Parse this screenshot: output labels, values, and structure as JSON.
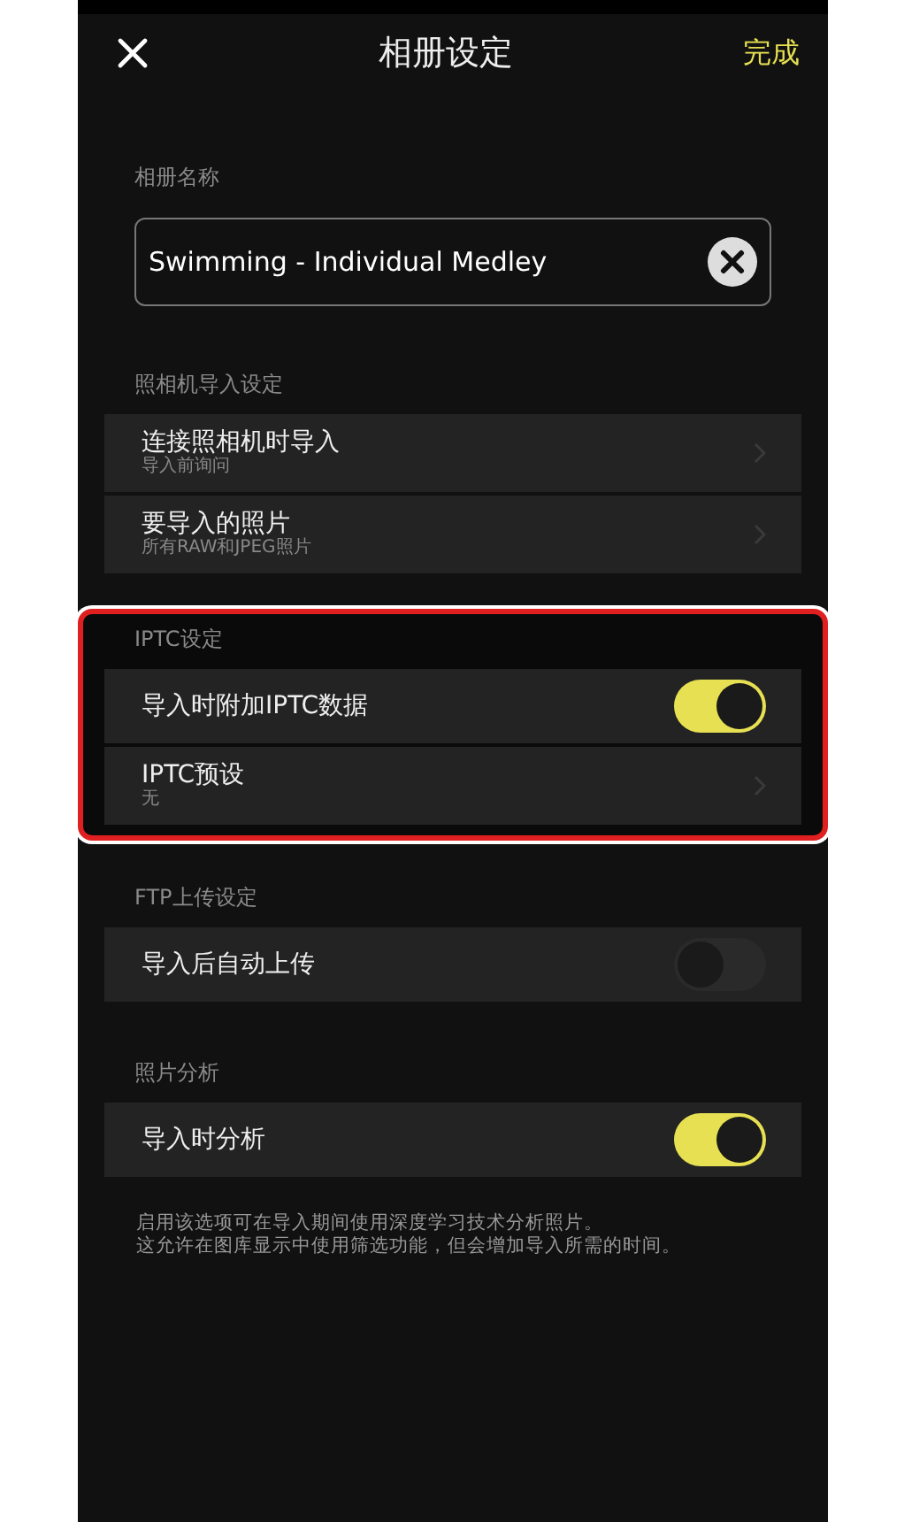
{
  "header": {
    "title": "相册设定",
    "done": "完成"
  },
  "album_name": {
    "label": "相册名称",
    "value": "Swimming - Individual Medley"
  },
  "sections": [
    {
      "title": "照相机导入设定",
      "highlighted": false,
      "rows": [
        {
          "kind": "link",
          "label": "连接照相机时导入",
          "sublabel": "导入前询问"
        },
        {
          "kind": "link",
          "label": "要导入的照片",
          "sublabel": "所有RAW和JPEG照片"
        }
      ]
    },
    {
      "title": "IPTC设定",
      "highlighted": true,
      "rows": [
        {
          "kind": "toggle",
          "label": "导入时附加IPTC数据",
          "on": true
        },
        {
          "kind": "link",
          "label": "IPTC预设",
          "sublabel": "无"
        }
      ]
    },
    {
      "title": "FTP上传设定",
      "highlighted": false,
      "rows": [
        {
          "kind": "toggle",
          "label": "导入后自动上传",
          "on": false
        }
      ]
    },
    {
      "title": "照片分析",
      "highlighted": false,
      "rows": [
        {
          "kind": "toggle",
          "label": "导入时分析",
          "on": true
        }
      ]
    }
  ],
  "note": [
    "启用该选项可在导入期间使用深度学习技术分析照片。",
    "这允许在图库显示中使用筛选功能，但会增加导入所需的时间。"
  ]
}
